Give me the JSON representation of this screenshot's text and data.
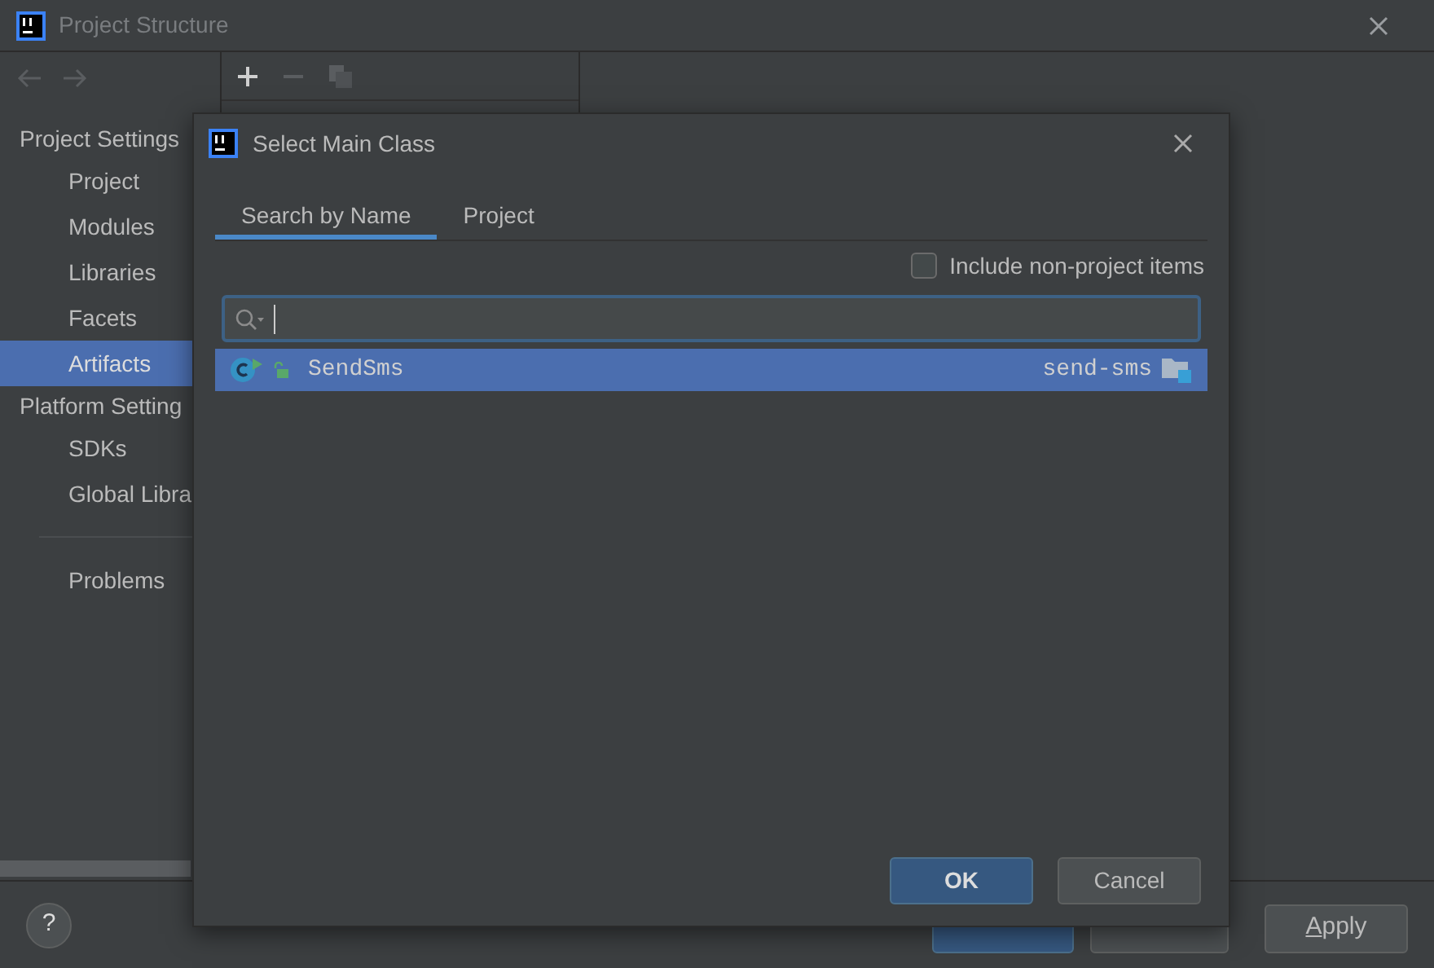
{
  "window": {
    "title": "Project Structure"
  },
  "sidebar": {
    "sections": [
      {
        "title": "Project Settings",
        "items": [
          {
            "label": "Project",
            "selected": false
          },
          {
            "label": "Modules",
            "selected": false
          },
          {
            "label": "Libraries",
            "selected": false
          },
          {
            "label": "Facets",
            "selected": false
          },
          {
            "label": "Artifacts",
            "selected": true
          }
        ]
      },
      {
        "title": "Platform Setting",
        "items": [
          {
            "label": "SDKs",
            "selected": false
          },
          {
            "label": "Global Libra",
            "selected": false
          }
        ]
      },
      {
        "items": [
          {
            "label": "Problems",
            "selected": false
          }
        ]
      }
    ]
  },
  "footer": {
    "help": "?",
    "buttons": [
      {
        "kind": "primary"
      },
      {
        "kind": "secondary"
      },
      {
        "kind": "mnemonic",
        "mnemonic": "A",
        "label": "pply"
      }
    ]
  },
  "dialog": {
    "title": "Select Main Class",
    "tabs": [
      {
        "label": "Search by Name",
        "selected": true
      },
      {
        "label": "Project",
        "selected": false
      }
    ],
    "include_non_project": {
      "label": "Include non-project items",
      "checked": false
    },
    "results": [
      {
        "name": "SendSms",
        "module": "send-sms",
        "selected": true
      }
    ],
    "buttons": [
      {
        "label": "OK",
        "kind": "primary"
      },
      {
        "label": "Cancel",
        "kind": "secondary"
      }
    ]
  }
}
